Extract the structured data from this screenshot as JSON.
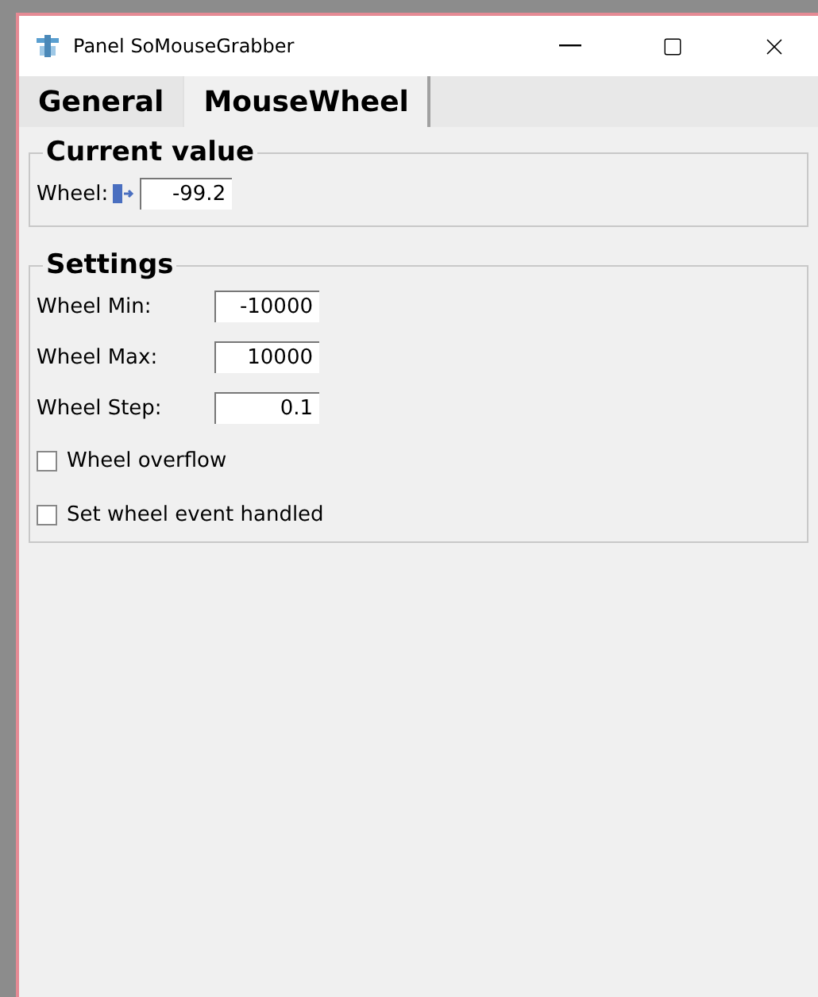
{
  "window": {
    "title": "Panel SoMouseGrabber"
  },
  "tabs": [
    {
      "label": "General",
      "selected": false
    },
    {
      "label": "MouseWheel",
      "selected": true
    }
  ],
  "current_value": {
    "title": "Current value",
    "label": "Wheel:",
    "value": "-99.2"
  },
  "settings": {
    "title": "Settings",
    "fields": [
      {
        "label": "Wheel Min:",
        "value": "-10000"
      },
      {
        "label": "Wheel Max:",
        "value": "10000"
      },
      {
        "label": "Wheel Step:",
        "value": "0.1"
      }
    ],
    "checkboxes": [
      {
        "label": "Wheel overflow",
        "checked": false
      },
      {
        "label": "Set wheel event handled",
        "checked": false
      }
    ]
  }
}
